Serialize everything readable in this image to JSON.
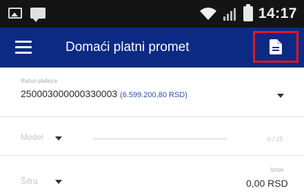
{
  "status_bar": {
    "time": "14:17",
    "icons": [
      "image-icon",
      "message-icon",
      "wifi-icon",
      "signal-icon",
      "battery-icon"
    ]
  },
  "app_bar": {
    "title": "Domaći platni promet",
    "menu_icon": "menu-icon",
    "action_icon": "document-icon",
    "background_color": "#0c2a84",
    "highlight_color": "#e8141f"
  },
  "form": {
    "account": {
      "label": "Račun platioca",
      "number": "250003000000330003",
      "balance": "(6.599.200,80 RSD)"
    },
    "model": {
      "label": "Model",
      "counter": "0 / 25"
    },
    "amount": {
      "label": "Iznos",
      "select_label": "Šifra",
      "value": "0,00 RSD"
    }
  }
}
